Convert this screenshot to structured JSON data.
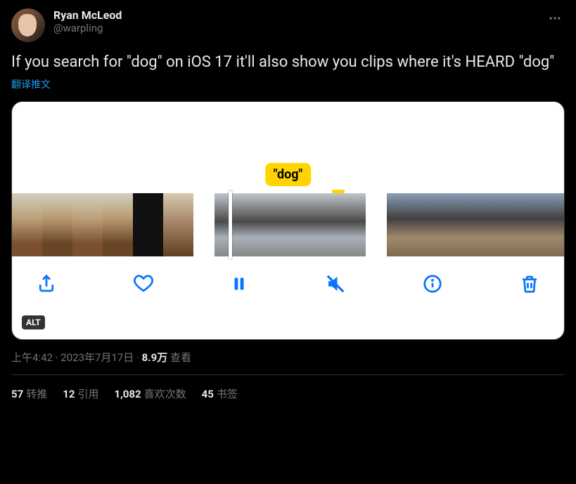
{
  "author": {
    "display_name": "Ryan McLeod",
    "handle": "@warpling"
  },
  "tweet_text": "If you search for \"dog\" on iOS 17 it'll also show you clips where it's HEARD \"dog\"",
  "translate_label": "翻译推文",
  "media": {
    "caption_pill": "\"dog\"",
    "alt_badge": "ALT",
    "toolbar_icons": [
      "share",
      "heart",
      "pause",
      "mute",
      "info",
      "trash"
    ]
  },
  "timestamp": "上午4:42 · 2023年7月17日",
  "views_count": "8.9万",
  "views_label": "查看",
  "stats": {
    "retweets_count": "57",
    "retweets_label": "转推",
    "quotes_count": "12",
    "quotes_label": "引用",
    "likes_count": "1,082",
    "likes_label": "喜欢次数",
    "bookmarks_count": "45",
    "bookmarks_label": "书签"
  }
}
